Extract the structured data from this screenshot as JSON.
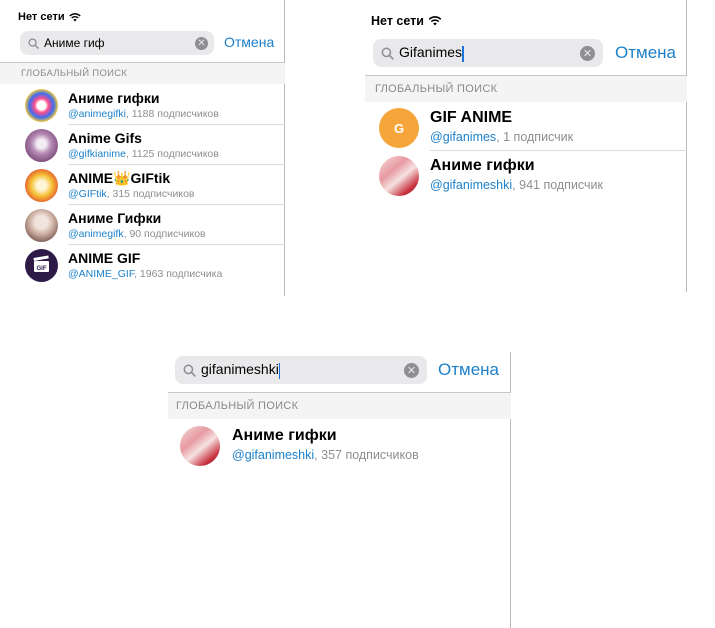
{
  "panel1": {
    "status": "Нет сети",
    "query": "Аниме гиф",
    "cancel": "Отмена",
    "section": "ГЛОБАЛЬНЫЙ ПОИСК",
    "results": [
      {
        "title": "Аниме гифки",
        "handle": "@animegifki",
        "count": ", 1188 подписчиков"
      },
      {
        "title": "Anime Gifs",
        "handle": "@gifkianime",
        "count": ", 1125 подписчиков"
      },
      {
        "title": "ANIME👑GIFtik",
        "handle": "@GIFtik",
        "count": ", 315 подписчиков"
      },
      {
        "title": "Аниме Гифки",
        "handle": "@animegifk",
        "count": ", 90 подписчиков"
      },
      {
        "title": "ANIME GIF",
        "handle": "@ANIME_GIF",
        "count": ", 1963 подписчика"
      }
    ]
  },
  "panel2": {
    "status": "Нет сети",
    "query": "Gifanimes",
    "cancel": "Отмена",
    "section": "ГЛОБАЛЬНЫЙ ПОИСК",
    "results": [
      {
        "title": "GIF ANIME",
        "handle": "@gifanimes",
        "count": ", 1 подписчик",
        "initial": "G"
      },
      {
        "title": "Аниме гифки",
        "handle": "@gifanimeshki",
        "count": ", 941 подписчик"
      }
    ]
  },
  "panel3": {
    "query": "gifanimeshki",
    "cancel": "Отмена",
    "section": "ГЛОБАЛЬНЫЙ ПОИСК",
    "results": [
      {
        "title": "Аниме гифки",
        "handle": "@gifanimeshki",
        "count": ", 357 подписчиков"
      }
    ]
  },
  "colors": {
    "accent": "#1d80c9",
    "section_bg": "#f4f4f5",
    "search_bg": "#e9e9eb",
    "avatar_gif_anime": "#f5a53a"
  }
}
